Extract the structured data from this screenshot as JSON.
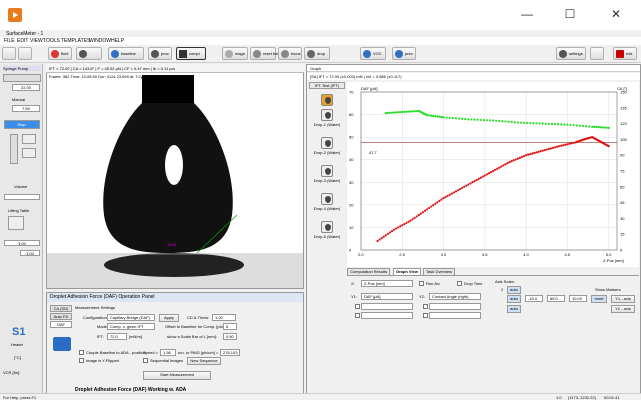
{
  "app": {
    "title": "SurfaceMeter - 1",
    "minimize": "—",
    "maximize": "☐",
    "close": "✕"
  },
  "menu": [
    "FILE",
    "EDIT",
    "VIEW",
    "TOOLS",
    "TEMPLATES",
    "WINDOW",
    "HELP"
  ],
  "toolbar": {
    "buttons": [
      "fluid",
      "baseline",
      "proc",
      "compl",
      "magn",
      "reset timer",
      "focus",
      "drop",
      "VOC",
      "prev"
    ],
    "settings": "settings",
    "exit": "exit"
  },
  "left_panel": {
    "syringe_label": "Syringe Pump",
    "syringe_value": "22.00",
    "rate_label": "Manual",
    "rate_value": "7.50",
    "dosing_btn": "Disp.",
    "volume_label": "Volume",
    "lifting_label": "Lifting Table",
    "lifting_value": "3.00",
    "bottom_value": "3.00",
    "s1": "S1",
    "heater": "Heater",
    "temp_label": "[°C]",
    "voltage_label": "VCR [5s]:"
  },
  "video": {
    "info": "IFT = 72.00 | CA = 143.8° | F = 45.52 µN | CF = 0.47 mm | Ib = 0.11 µm",
    "sub": "Frame: 382   Time: 10:28:00   Dur: 412s   23.699   dt: T:2µs",
    "marker": "1433"
  },
  "operation_panel": {
    "title": "Droplet Adhesion Force (DAF) Operation Panel",
    "sidetabs": [
      "CA (SD)",
      "Auto FD",
      "DAF"
    ],
    "group": "Measurement Settings",
    "config_label": "Configuration:",
    "config_value": "Capillary Bridge (DAF)",
    "apply": "Apply",
    "cd_label": "CD & Theta:",
    "cd_value": "1.20",
    "mode_label": "Mode:",
    "mode_value": "Comp. v. given IFT",
    "offset_label": "Offset to Baseline for Comp. [pixel]:",
    "offset_value": "5",
    "ift_label": "IFT:",
    "ift_value": "72.0",
    "ift_unit": "[mN/m]",
    "scale_label": "show a Scale Bar of L [mm]:",
    "scale_value": "0.50",
    "couple_label": "Couple Baseline to ADA - position",
    "image_label": "Image is Y-Flipped",
    "speed_label": "Speed =",
    "speed_value": "1.56",
    "speed_unit": "um, or PAIG [pix/um] =",
    "speed_value2": "276.103",
    "seq_label": "Sequential Images",
    "new_seq": "New Sequence",
    "start_btn": "Start Measurement",
    "footer": "Droplet Adhesion Force (DAF) Working w. ADA"
  },
  "graph": {
    "window_title": "Graph",
    "info": "[SA] IFT = 72.00 (±0.000) mN | Vol = 3.686 (±0.117)",
    "drops": [
      "IFT-Test (IFT)",
      "Drop-1 (Water)",
      "Drop-2 (Water)",
      "Drop-3 (Water)",
      "Drop-4 (Water)",
      "Drop-5 (Water)"
    ],
    "tabs": [
      "Computation Results",
      "Graph View",
      "Task Overview"
    ],
    "refline_label": "47.7"
  },
  "chart_data": {
    "type": "scatter",
    "xlabel": "Z-Pos [mm]",
    "ylabel": "DAF [µN]",
    "y2label": "CA [°]",
    "xlim": [
      2.0,
      5.1
    ],
    "ylim": [
      0,
      70
    ],
    "y2lim": [
      0,
      150
    ],
    "x_ticks": [
      "2.0",
      "2.5",
      "3.0",
      "3.5",
      "4.0",
      "4.5",
      "5.0"
    ],
    "y_ticks": [
      "0",
      "10",
      "20",
      "30",
      "40",
      "50",
      "60",
      "70"
    ],
    "y2_ticks": [
      "0",
      "15",
      "30",
      "45",
      "60",
      "75",
      "90",
      "105",
      "120",
      "135",
      "150"
    ],
    "grid": true,
    "series": [
      {
        "color": "#22dd22",
        "x": [
          2.3,
          2.5,
          2.7,
          2.8,
          3.0,
          3.3,
          3.6,
          3.9,
          4.2,
          4.5,
          4.8,
          5.0
        ],
        "y": [
          130,
          131,
          132,
          128,
          126,
          124,
          123,
          121,
          120,
          119,
          117,
          116
        ]
      },
      {
        "color": "#dd1111",
        "x": [
          2.2,
          2.4,
          2.6,
          2.8,
          3.0,
          3.2,
          3.4,
          3.6,
          3.8,
          4.0,
          4.2,
          4.4,
          4.6,
          4.7,
          4.8,
          4.9,
          5.0
        ],
        "y": [
          4,
          9,
          13,
          18,
          23,
          27,
          31,
          35,
          39,
          42,
          44,
          46,
          47.7,
          49,
          50,
          48,
          46
        ]
      }
    ]
  },
  "graph_controls": {
    "x_label": "X:",
    "x_value": "Z-Pos [mm]",
    "y1_label": "Y1:",
    "y1_value": "DAF [µN]",
    "y2_label": "Y2:",
    "y2_value": "Contact Angle (right)",
    "runno": "Run-No",
    "droptime": "Drop Time",
    "axis_scale": "Axis Scale:",
    "x_auto": "auto",
    "y1_auto": "auto",
    "y2_auto": "auto",
    "y1_min": "-15.0",
    "y1_max": "65.0",
    "y1_step": "10.00",
    "show_markers": "Show Markers",
    "reset": "reset",
    "y1_axis": "Y1 - axis",
    "y2_axis": "Y2 - axis"
  },
  "status": {
    "help": "For Help, press F1",
    "pos": "1:0",
    "coord": "(1173, 1232.22)",
    "time": "00:01:41"
  },
  "colors": {
    "accent": "#2b6cc4",
    "green_series": "#22dd22",
    "red_series": "#dd1111",
    "refline": "#a03030"
  }
}
